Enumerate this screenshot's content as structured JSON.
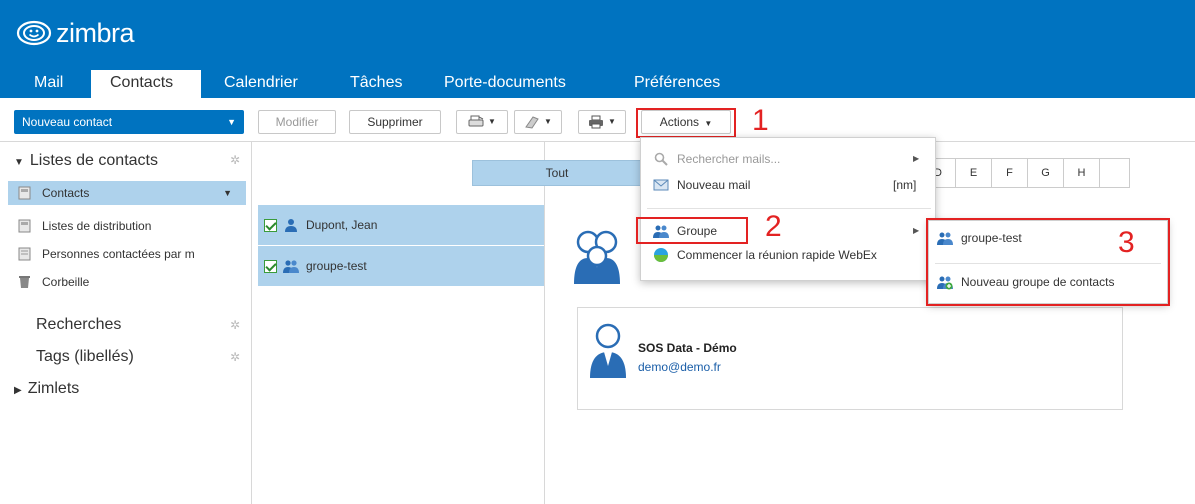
{
  "app": {
    "logo_text": "zimbra"
  },
  "tabs": [
    {
      "label": "Mail"
    },
    {
      "label": "Contacts",
      "active": true
    },
    {
      "label": "Calendrier"
    },
    {
      "label": "Tâches"
    },
    {
      "label": "Porte-documents"
    },
    {
      "label": "Préférences"
    }
  ],
  "toolbar": {
    "new_contact": "Nouveau contact",
    "edit": "Modifier",
    "delete": "Supprimer",
    "actions": "Actions"
  },
  "steps": {
    "one": "1",
    "two": "2",
    "three": "3"
  },
  "sidebar": {
    "lists_title": "Listes de contacts",
    "items": [
      {
        "label": "Contacts",
        "selected": true
      },
      {
        "label": "Listes de distribution"
      },
      {
        "label": "Personnes contactées par m"
      },
      {
        "label": "Corbeille"
      }
    ],
    "searches": "Recherches",
    "tags": "Tags (libellés)",
    "zimlets": "Zimlets"
  },
  "contact_list": [
    {
      "label": "Dupont, Jean"
    },
    {
      "label": "groupe-test"
    }
  ],
  "alphabet": {
    "all": "Tout",
    "letters": [
      "E",
      "F",
      "G",
      "H"
    ]
  },
  "detail": {
    "name": "SOS Data - Démo",
    "email": "demo@demo.fr"
  },
  "actions_menu": {
    "search_mails": "Rechercher mails...",
    "new_mail": "Nouveau mail",
    "new_mail_shortcut": "[nm]",
    "group": "Groupe",
    "webex": "Commencer la réunion rapide WebEx"
  },
  "group_submenu": {
    "existing_group": "groupe-test",
    "new_group": "Nouveau groupe de contacts"
  },
  "colors": {
    "brand": "#0073c0",
    "selection": "#aed2ec",
    "annotation": "#e32222"
  }
}
